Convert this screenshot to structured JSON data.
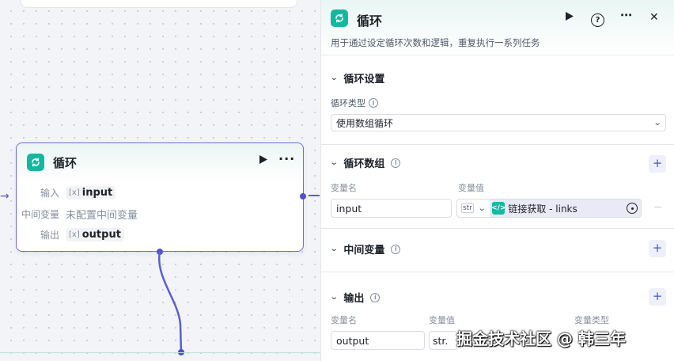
{
  "canvas": {
    "node": {
      "title": "循环",
      "input_label": "输入",
      "input_var": "input",
      "mid_label": "中间变量",
      "mid_value": "未配置中间变量",
      "output_label": "输出",
      "output_var": "output",
      "var_prefix": "[x]"
    },
    "arrow": "→"
  },
  "panel": {
    "title": "循环",
    "description": "用于通过设定循环次数和逻辑，重复执行一系列任务",
    "run": "▶",
    "help": "?",
    "more": "⋯",
    "close": "✕",
    "loop_settings": {
      "title": "循环设置",
      "type_label": "循环类型",
      "type_value": "使用数组循环"
    },
    "loop_array": {
      "title": "循环数组",
      "col_name": "变量名",
      "col_value": "变量值",
      "row": {
        "name": "input",
        "type": "str",
        "ref": "链接获取 - links"
      }
    },
    "mid_vars": {
      "title": "中间变量"
    },
    "output": {
      "title": "输出",
      "col_name": "变量名",
      "col_value": "变量值",
      "col_type": "变量类型",
      "row": {
        "name": "output",
        "type": "str."
      }
    },
    "plus": "+",
    "minus": "−"
  },
  "watermark": "掘金技术社区 @ 韩三年",
  "colors": {
    "accent": "#4e54c8",
    "teal": "#14b8a0"
  }
}
